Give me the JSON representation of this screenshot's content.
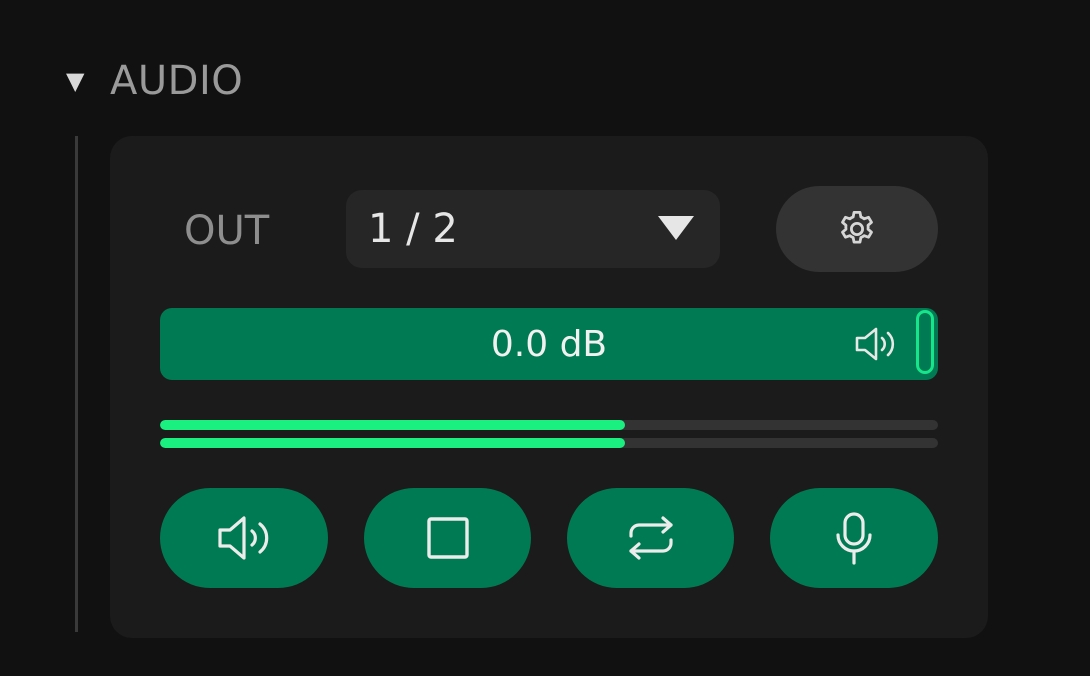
{
  "section": {
    "title": "AUDIO",
    "expanded": true
  },
  "output": {
    "label": "OUT",
    "selected": "1 / 2"
  },
  "volume": {
    "text": "0.0 dB",
    "level": 1.0
  },
  "meters": {
    "left": 0.598,
    "right": 0.598
  },
  "colors": {
    "accent": "#007a52",
    "meter": "#19f080",
    "handle": "#16e58a",
    "background": "#111111",
    "panel": "#1b1b1b"
  },
  "icons": {
    "settings": "gear-icon",
    "volume": "speaker-icon",
    "stop": "square-icon",
    "loop": "repeat-icon",
    "record": "microphone-icon"
  }
}
